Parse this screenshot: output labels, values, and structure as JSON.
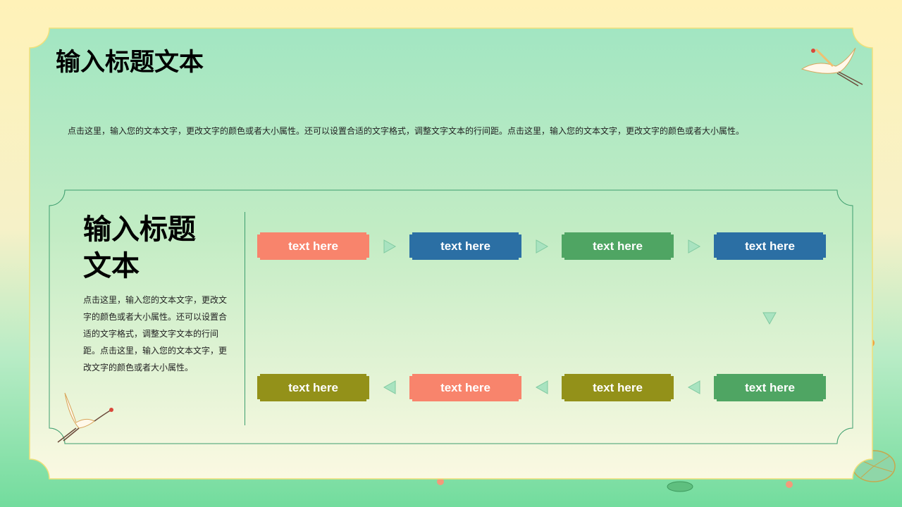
{
  "slide": {
    "title": "输入标题文本",
    "description": "点击这里，输入您的文本文字，更改文字的颜色或者大小属性。还可以设置合适的文字格式，调整文字文本的行间距。点击这里，输入您的文本文字，更改文字的颜色或者大小属性。"
  },
  "card": {
    "title_line1": "输入标题",
    "title_line2": "文本",
    "description": "点击这里，输入您的文本文字，更改文字的颜色或者大小属性。还可以设置合适的文字格式，调整文字文本的行间距。点击这里，输入您的文本文字，更改文字的颜色或者大小属性。"
  },
  "flow": {
    "top_row": [
      {
        "label": "text here",
        "color": "#f8846c"
      },
      {
        "label": "text here",
        "color": "#2b6fa4"
      },
      {
        "label": "text here",
        "color": "#4fa563"
      },
      {
        "label": "text here",
        "color": "#2b6fa4"
      }
    ],
    "bottom_row": [
      {
        "label": "text here",
        "color": "#939119"
      },
      {
        "label": "text here",
        "color": "#f8846c"
      },
      {
        "label": "text here",
        "color": "#939119"
      },
      {
        "label": "text here",
        "color": "#4fa563"
      }
    ]
  },
  "colors": {
    "panel_border": "#f0e07a",
    "card_border": "#3d9e6e",
    "arrow_fill": "#a9e3c0"
  },
  "decor": {
    "top_right": "crane-icon",
    "bottom_left": "crane-icon",
    "bottom_right": "lotus-leaf-icon"
  }
}
